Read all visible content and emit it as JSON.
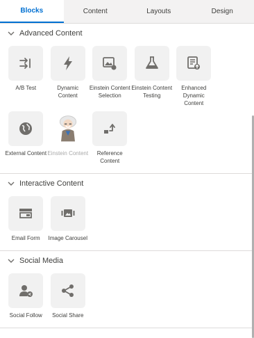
{
  "tabs": [
    {
      "label": "Blocks"
    },
    {
      "label": "Content"
    },
    {
      "label": "Layouts"
    },
    {
      "label": "Design"
    }
  ],
  "sections": [
    {
      "title": "Advanced Content",
      "items": [
        {
          "label": "A/B Test",
          "icon": "ab-test-icon"
        },
        {
          "label": "Dynamic Content",
          "icon": "lightning-icon"
        },
        {
          "label": "Einstein Content Selection",
          "icon": "image-selection-icon"
        },
        {
          "label": "Einstein Content Testing",
          "icon": "flask-icon"
        },
        {
          "label": "Enhanced Dynamic Content",
          "icon": "document-upload-icon"
        },
        {
          "label": "External Content",
          "icon": "globe-icon"
        },
        {
          "label": "Einstein Content",
          "icon": "einstein-avatar"
        },
        {
          "label": "Reference Content",
          "icon": "reference-arrow-icon"
        }
      ]
    },
    {
      "title": "Interactive Content",
      "items": [
        {
          "label": "Email Form",
          "icon": "form-icon"
        },
        {
          "label": "Image Carousel",
          "icon": "carousel-icon"
        }
      ]
    },
    {
      "title": "Social Media",
      "items": [
        {
          "label": "Social Follow",
          "icon": "follow-user-icon"
        },
        {
          "label": "Social Share",
          "icon": "share-icon"
        }
      ]
    }
  ],
  "colors": {
    "active_tab": "#0070d2",
    "icon": "#706e6b"
  }
}
